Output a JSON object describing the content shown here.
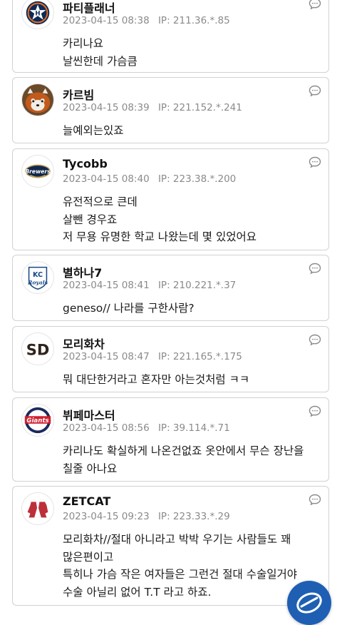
{
  "comments": [
    {
      "author": "파티플래너",
      "date": "2023-04-15 08:38",
      "ip_label": "IP:",
      "ip": "211.36.*.85",
      "lines": [
        "카리나요",
        "날씬한데 가슴큼"
      ],
      "avatar_icon": "astros-logo"
    },
    {
      "author": "카르빔",
      "date": "2023-04-15 08:39",
      "ip_label": "IP:",
      "ip": "221.152.*.241",
      "lines": [
        "늘예외는있죠"
      ],
      "avatar_icon": "red-panda-photo"
    },
    {
      "author": "Tycobb",
      "date": "2023-04-15 08:40",
      "ip_label": "IP:",
      "ip": "223.38.*.200",
      "lines": [
        "유전적으로 큰데",
        "살뺀 경우죠",
        "저 무용 유명한 학교 나왔는데 몇 있었어요"
      ],
      "avatar_icon": "brewers-logo"
    },
    {
      "author": "별하나7",
      "date": "2023-04-15 08:41",
      "ip_label": "IP:",
      "ip": "210.221.*.37",
      "lines": [
        "geneso// 나라를 구한사람?"
      ],
      "avatar_icon": "royals-logo"
    },
    {
      "author": "모리화차",
      "date": "2023-04-15 08:47",
      "ip_label": "IP:",
      "ip": "221.165.*.175",
      "lines": [
        "뭐 대단한거라고 혼자만 아는것처럼 ㅋㅋ"
      ],
      "avatar_icon": "padres-logo"
    },
    {
      "author": "뷔페마스터",
      "date": "2023-04-15 08:56",
      "ip_label": "IP:",
      "ip": "39.114.*.71",
      "lines": [
        "카리나도 확실하게 나온건없죠 옷안에서 무슨 장난을",
        "칠줄 아나요"
      ],
      "avatar_icon": "giants-logo"
    },
    {
      "author": "ZETCAT",
      "date": "2023-04-15 09:23",
      "ip_label": "IP:",
      "ip": "223.33.*.29",
      "lines": [
        "모리화차//절대 아니라고 박박 우기는 사람들도 꽤",
        "많은편이고",
        "특히나 가슴 작은 여자들은 그런건 절대 수술일거야",
        "수술 아닐리 없어 T.T 라고 하죠."
      ],
      "avatar_icon": "red-sox-logo"
    }
  ],
  "reply_icon": "comment-bubble-icon",
  "fab_icon": "app-shortcut-icon",
  "colors": {
    "card_border": "#d2d2d2",
    "meta_text": "#8a8a8a",
    "fab": "#1e5fb3"
  }
}
